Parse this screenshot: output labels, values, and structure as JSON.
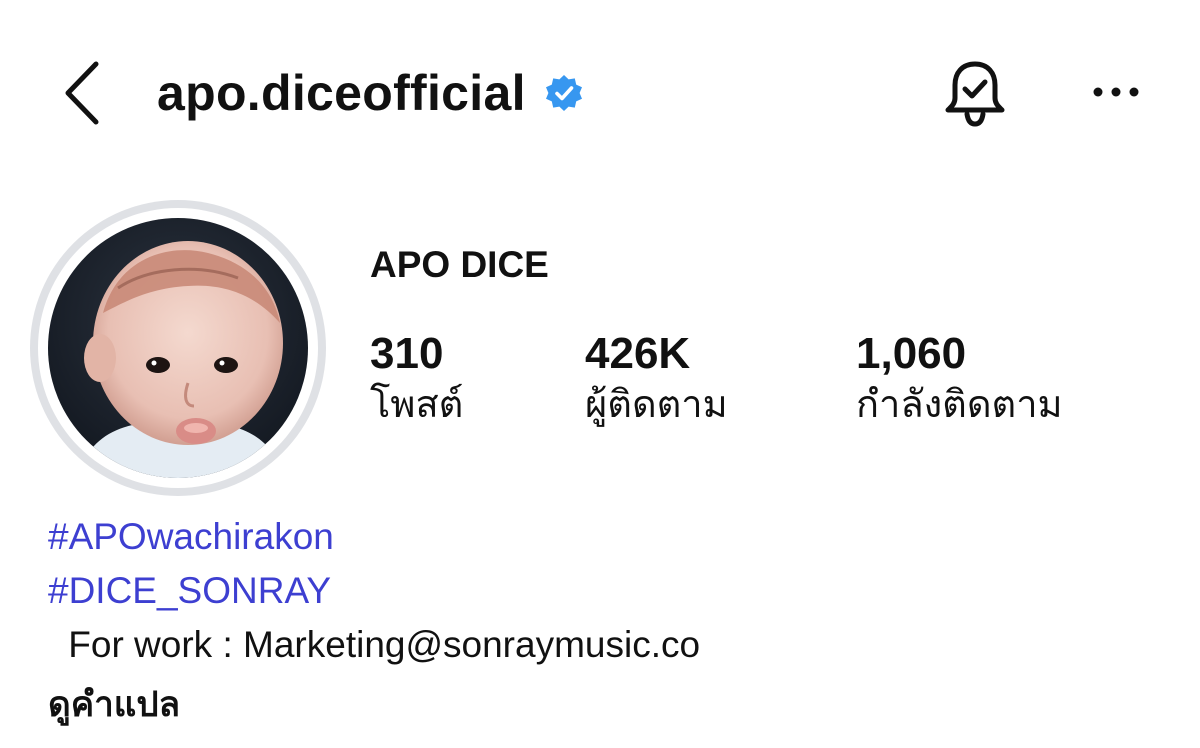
{
  "header": {
    "username": "apo.diceofficial",
    "icons": {
      "back": "chevron-left-icon",
      "verified": "verified-badge-icon",
      "notifications": "bell-check-icon",
      "more": "more-horizontal-icon"
    },
    "colors": {
      "verified": "#3797f0"
    }
  },
  "profile": {
    "display_name": "APO DICE",
    "avatar": "baby-photo-avatar",
    "stats": [
      {
        "value": "310",
        "label": "โพสต์"
      },
      {
        "value": "426K",
        "label": "ผู้ติดตาม"
      },
      {
        "value": "1,060",
        "label": "กำลังติดตาม"
      }
    ]
  },
  "bio": {
    "hashtags": [
      "#APOwachirakon",
      "#DICE_SONRAY"
    ],
    "contact": " For work : Marketing@sonraymusic.co",
    "translate_label": "ดูคำแปล",
    "colors": {
      "hashtag": "#3d3fd1"
    }
  }
}
